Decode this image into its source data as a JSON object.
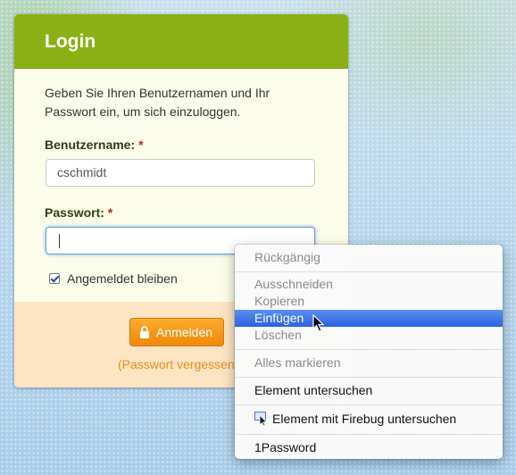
{
  "login": {
    "title": "Login",
    "intro": "Geben Sie Ihren Benutzernamen und Ihr Passwort ein, um sich einzuloggen.",
    "username_label": "Benutzername:",
    "username_value": "cschmidt",
    "password_label": "Passwort:",
    "password_value": "",
    "required_mark": "*",
    "remember_label": "Angemeldet bleiben",
    "remember_checked": true,
    "submit_label": "Anmelden",
    "forgot_label": "(Passwort vergessen"
  },
  "context_menu": {
    "undo": "Rückgängig",
    "cut": "Ausschneiden",
    "copy": "Kopieren",
    "paste": "Einfügen",
    "delete": "Löschen",
    "select_all": "Alles markieren",
    "inspect": "Element untersuchen",
    "firebug": "Element mit Firebug untersuchen",
    "onepassword": "1Password",
    "highlighted_item": "Einfügen"
  },
  "colors": {
    "header_green": "#8bb014",
    "panel_bg": "#fbfdea",
    "footer_bg": "#fde4c3",
    "button_orange": "#f59a1b",
    "menu_highlight": "#3a72e6",
    "required_red": "#cc1a1a"
  },
  "icons": {
    "button": "lock-icon",
    "firebug": "firebug-inspect-icon",
    "pointer": "mouse-cursor-icon"
  }
}
